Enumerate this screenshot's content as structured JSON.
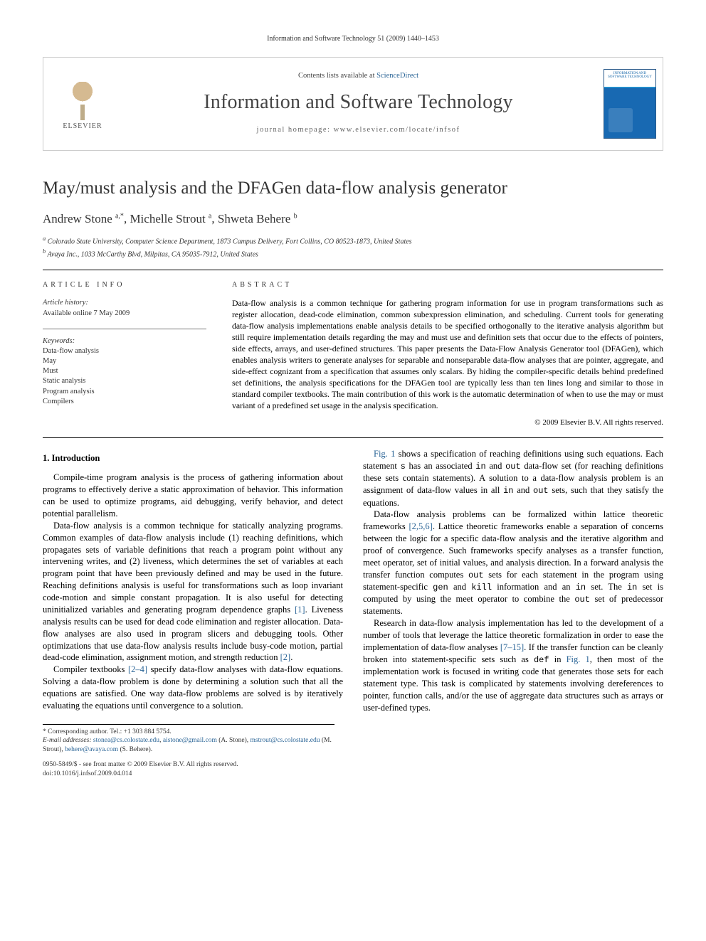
{
  "running_head": "Information and Software Technology 51 (2009) 1440–1453",
  "masthead": {
    "publisher": "ELSEVIER",
    "contents_prefix": "Contents lists available at ",
    "contents_link": "ScienceDirect",
    "journal": "Information and Software Technology",
    "homepage_prefix": "journal homepage: ",
    "homepage": "www.elsevier.com/locate/infsof",
    "cover_caption": "INFORMATION AND SOFTWARE TECHNOLOGY"
  },
  "title": "May/must analysis and the DFAGen data-flow analysis generator",
  "authors_html": "Andrew Stone <sup>a,*</sup>, Michelle Strout <sup>a</sup>, Shweta Behere <sup>b</sup>",
  "affiliations": [
    "a Colorado State University, Computer Science Department, 1873 Campus Delivery, Fort Collins, CO 80523-1873, United States",
    "b Avaya Inc., 1033 McCarthy Blvd, Milpitas, CA 95035-7912, United States"
  ],
  "info_head": "ARTICLE INFO",
  "abstract_head": "ABSTRACT",
  "history": {
    "label": "Article history:",
    "line": "Available online 7 May 2009"
  },
  "keywords": {
    "label": "Keywords:",
    "items": [
      "Data-flow analysis",
      "May",
      "Must",
      "Static analysis",
      "Program analysis",
      "Compilers"
    ]
  },
  "abstract": "Data-flow analysis is a common technique for gathering program information for use in program transformations such as register allocation, dead-code elimination, common subexpression elimination, and scheduling. Current tools for generating data-flow analysis implementations enable analysis details to be specified orthogonally to the iterative analysis algorithm but still require implementation details regarding the may and must use and definition sets that occur due to the effects of pointers, side effects, arrays, and user-defined structures. This paper presents the Data-Flow Analysis Generator tool (DFAGen), which enables analysis writers to generate analyses for separable and nonseparable data-flow analyses that are pointer, aggregate, and side-effect cognizant from a specification that assumes only scalars. By hiding the compiler-specific details behind predefined set definitions, the analysis specifications for the DFAGen tool are typically less than ten lines long and similar to those in standard compiler textbooks. The main contribution of this work is the automatic determination of when to use the may or must variant of a predefined set usage in the analysis specification.",
  "copyright": "© 2009 Elsevier B.V. All rights reserved.",
  "section1": "1. Introduction",
  "body": {
    "p1": "Compile-time program analysis is the process of gathering information about programs to effectively derive a static approximation of behavior. This information can be used to optimize programs, aid debugging, verify behavior, and detect potential parallelism.",
    "p2a": "Data-flow analysis is a common technique for statically analyzing programs. Common examples of data-flow analysis include (1) reaching definitions, which propagates sets of variable definitions that reach a program point without any intervening writes, and (2) liveness, which determines the set of variables at each program point that have been previously defined and may be used in the future. Reaching definitions analysis is useful for transformations such as loop invariant code-motion and simple constant propagation. It is also useful for detecting uninitialized variables and generating program dependence graphs ",
    "r1": "[1]",
    "p2b": ". Liveness analysis results can be used for dead code elimination and register allocation. Data-flow analyses are also used in program slicers and debugging tools. Other optimizations that use data-flow analysis results include busy-code motion, partial dead-code elimination, assignment motion, and strength reduction ",
    "r2": "[2]",
    "p2c": ".",
    "p3a": "Compiler textbooks ",
    "r24": "[2–4]",
    "p3b": " specify data-flow analyses with data-flow equations. Solving a data-flow problem is done by determining a solution such that all the equations are satisfied. One way data-flow problems are solved is by iteratively evaluating the equations until convergence to a solution.",
    "p4a": "",
    "fig1": "Fig. 1",
    "p4b": " shows a specification of reaching definitions using such equations. Each statement ",
    "s": "s",
    "p4c": " has an associated ",
    "in": "in",
    "p4d": " and ",
    "out": "out",
    "p4e": " data-flow set (for reaching definitions these sets contain statements). A solution to a data-flow analysis problem is an assignment of data-flow values in all ",
    "p4f": " and ",
    "p4g": " sets, such that they satisfy the equations.",
    "p5a": "Data-flow analysis problems can be formalized within lattice theoretic frameworks ",
    "r256": "[2,5,6]",
    "p5b": ". Lattice theoretic frameworks enable a separation of concerns between the logic for a specific data-flow analysis and the iterative algorithm and proof of convergence. Such frameworks specify analyses as a transfer function, meet operator, set of initial values, and analysis direction. In a forward analysis the transfer function computes ",
    "p5c": " sets for each statement in the program using statement-specific ",
    "gen": "gen",
    "p5d": " and ",
    "kill": "kill",
    "p5e": " information and an ",
    "p5f": " set. The ",
    "p5g": " set is computed by using the meet operator to combine the ",
    "p5h": " set of predecessor statements.",
    "p6a": "Research in data-flow analysis implementation has led to the development of a number of tools that leverage the lattice theoretic formalization in order to ease the implementation of data-flow analyses ",
    "r715": "[7–15]",
    "p6b": ". If the transfer function can be cleanly broken into statement-specific sets such as ",
    "def": "def",
    "p6c": " in ",
    "p6d": ", then most of the implementation work is focused in writing code that generates those sets for each statement type. This task is complicated by statements involving dereferences to pointer, function calls, and/or the use of aggregate data structures such as arrays or user-defined types."
  },
  "footnotes": {
    "corr": "* Corresponding author. Tel.: +1 303 884 5754.",
    "email_label": "E-mail addresses:",
    "emails": [
      {
        "addr": "stonea@cs.colostate.edu",
        "who": ""
      },
      {
        "addr": "aistone@gmail.com",
        "who": " (A. Stone),"
      },
      {
        "addr": "mstrout@cs.colostate.edu",
        "who": " (M. Strout),"
      },
      {
        "addr": "behere@avaya.com",
        "who": " (S. Behere)."
      }
    ]
  },
  "bottom": {
    "line1": "0950-5849/$ - see front matter © 2009 Elsevier B.V. All rights reserved.",
    "line2": "doi:10.1016/j.infsof.2009.04.014"
  }
}
